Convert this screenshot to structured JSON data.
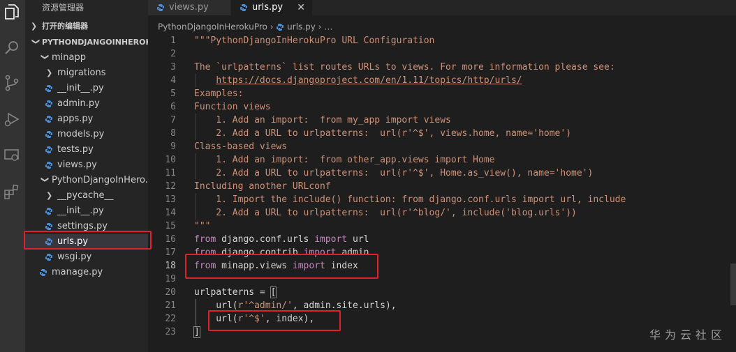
{
  "sidebar": {
    "title": "资源管理器",
    "open_editors": "打开的编辑器",
    "root": "PYTHONDJANGOINHEROK...",
    "tree": [
      {
        "label": "minapp",
        "type": "folder-open"
      },
      {
        "label": "migrations",
        "type": "folder-closed"
      },
      {
        "label": "__init__.py",
        "type": "file"
      },
      {
        "label": "admin.py",
        "type": "file"
      },
      {
        "label": "apps.py",
        "type": "file"
      },
      {
        "label": "models.py",
        "type": "file"
      },
      {
        "label": "tests.py",
        "type": "file"
      },
      {
        "label": "views.py",
        "type": "file"
      },
      {
        "label": "PythonDjangoInHero...",
        "type": "folder-open"
      },
      {
        "label": "__pycache__",
        "type": "folder-closed"
      },
      {
        "label": "__init__.py",
        "type": "file"
      },
      {
        "label": "settings.py",
        "type": "file"
      },
      {
        "label": "urls.py",
        "type": "file",
        "selected": true
      },
      {
        "label": "wsgi.py",
        "type": "file"
      },
      {
        "label": "manage.py",
        "type": "file"
      }
    ]
  },
  "tabs": [
    {
      "label": "views.py",
      "active": false
    },
    {
      "label": "urls.py",
      "active": true,
      "close": "✕"
    }
  ],
  "breadcrumb": {
    "project": "PythonDjangoInHerokuPro",
    "sep": "›",
    "file": "urls.py",
    "more": "…"
  },
  "editor": {
    "lines": [
      "1",
      "2",
      "3",
      "4",
      "5",
      "6",
      "7",
      "8",
      "9",
      "10",
      "11",
      "12",
      "13",
      "14",
      "15",
      "16",
      "17",
      "18",
      "19",
      "20",
      "21",
      "22",
      "23"
    ],
    "code": {
      "l1": "\"\"\"PythonDjangoInHerokuPro URL Configuration",
      "l3": "The `urlpatterns` list routes URLs to views. For more information please see:",
      "l4_link": "https://docs.djangoproject.com/en/1.11/topics/http/urls/",
      "l5": "Examples:",
      "l6": "Function views",
      "l7": "    1. Add an import:  from my_app import views",
      "l8": "    2. Add a URL to urlpatterns:  url(r'^$', views.home, name='home')",
      "l9": "Class-based views",
      "l10": "    1. Add an import:  from other_app.views import Home",
      "l11": "    2. Add a URL to urlpatterns:  url(r'^$', Home.as_view(), name='home')",
      "l12": "Including another URLconf",
      "l13": "    1. Import the include() function: from django.conf.urls import url, include",
      "l14": "    2. Add a URL to urlpatterns:  url(r'^blog/', include('blog.urls'))",
      "l15": "\"\"\"",
      "kw_from": "from",
      "kw_import": "import",
      "l16_mod": " django.conf.urls ",
      "l16_name": " url",
      "l17_mod": " django.contrib ",
      "l17_name": " admin",
      "l18_mod": " minapp.views ",
      "l18_name": " index",
      "l20_a": "urlpatterns = ",
      "l20_b": "[",
      "l21_a": "    url(",
      "l21_s": "r'^admin/'",
      "l21_b": ", admin.site.urls),",
      "l22_a": "    url(",
      "l22_s": "r'^$'",
      "l22_b": ", index),",
      "l23": "]"
    }
  },
  "watermark": "华为云社区",
  "colors": {
    "string": "#ce9178",
    "keyword": "#c586c0",
    "annotation": "#e0202a",
    "python_icon": "#4a90d9"
  }
}
